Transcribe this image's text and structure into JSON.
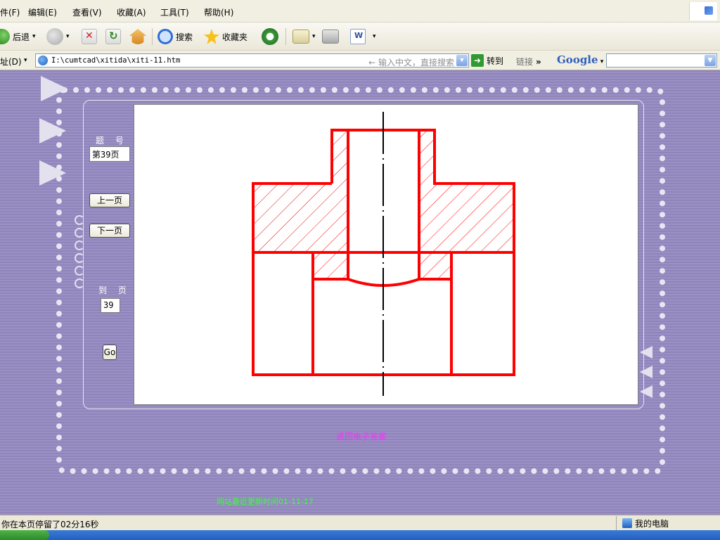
{
  "menu": {
    "items": [
      "件(F)",
      "编辑(E)",
      "查看(V)",
      "收藏(A)",
      "工具(T)",
      "帮助(H)"
    ]
  },
  "toolbar": {
    "back_label": "后退",
    "search_label": "搜索",
    "favorites_label": "收藏夹"
  },
  "address": {
    "label": "址(D)",
    "url": "I:\\cumtcad\\xitida\\xiti-11.htm",
    "hint": "← 输入中文，直接搜索",
    "go_label": "转到",
    "links_label": "链接",
    "links_more": "»",
    "google_label": "Google"
  },
  "page": {
    "question_label": "题 号",
    "question_value": "第39页",
    "prev_button": "上一页",
    "next_button": "下一页",
    "goto_label": "到 页",
    "goto_value": "39",
    "go_button": "Go",
    "return_link": "返回电子答案",
    "footer_text": "网站最近更新时间01-11-17"
  },
  "status": {
    "message": "你在本页停留了02分16秒",
    "zone": "我的电脑"
  },
  "colors": {
    "drawing_outline": "#ff0000",
    "hatch": "#ff0000",
    "centerline": "#000000",
    "background_purple": "#9a90c4",
    "return_link": "#ff2cff",
    "footer_text": "#39ff39"
  }
}
